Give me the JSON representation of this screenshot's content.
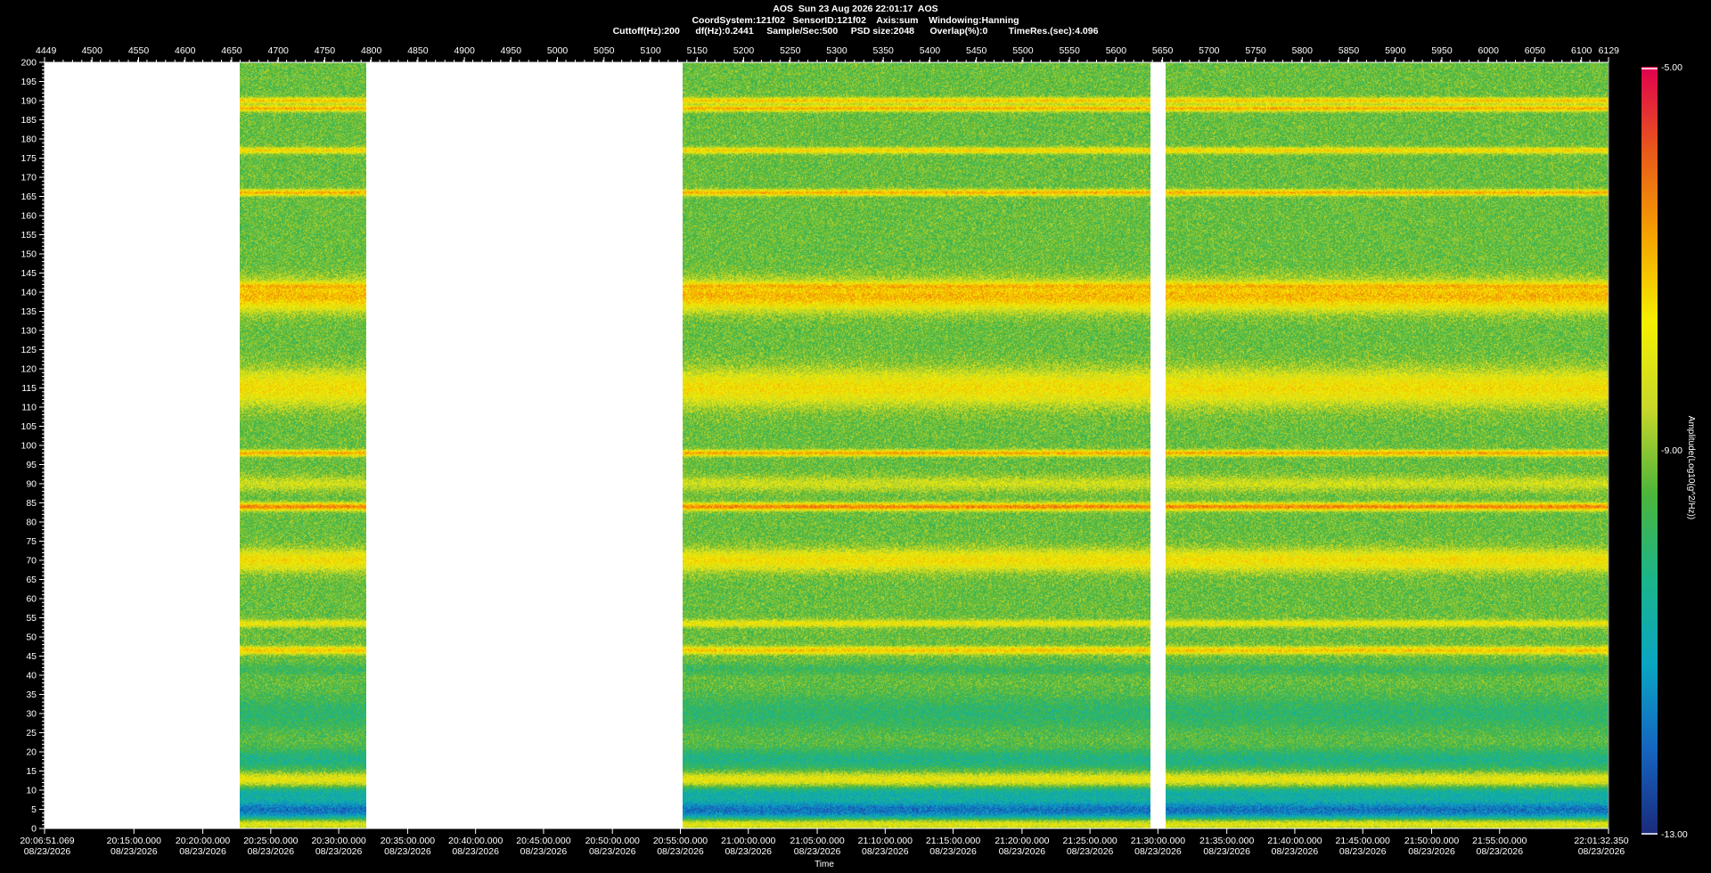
{
  "header": {
    "line1": "AOS  Sun 23 Aug 2026 22:01:17  AOS",
    "line2": "CoordSystem:121f02   SensorID:121f02    Axis:sum    Windowing:Hanning",
    "line3": "Cuttoff(Hz):200      df(Hz):0.2441     Sample/Sec:500     PSD size:2048      Overlap(%):0        TimeRes.(sec):4.096"
  },
  "chart_data": {
    "type": "heatmap",
    "title": "AOS  Sun 23 Aug 2026 22:01:17  AOS",
    "xlabel": "Time",
    "ylabel": "",
    "colorbar_label": "Amplitude(Log10(g^2/Hz))",
    "colorbar_range": [
      -13.0,
      -5.0
    ],
    "colorbar_ticks": [
      "-5.00",
      "-9.00",
      "-13.00"
    ],
    "colormap": [
      "#1a2a7a",
      "#1565c0",
      "#0aa5c2",
      "#1bb58a",
      "#4db53a",
      "#c8d72a",
      "#f5f000",
      "#f5a400",
      "#e85a1a",
      "#e00050"
    ],
    "ylim": [
      0,
      200
    ],
    "y_ticks": [
      0,
      5,
      10,
      15,
      20,
      25,
      30,
      35,
      40,
      45,
      50,
      55,
      60,
      65,
      70,
      75,
      80,
      85,
      90,
      95,
      100,
      105,
      110,
      115,
      120,
      125,
      130,
      135,
      140,
      145,
      150,
      155,
      160,
      165,
      170,
      175,
      180,
      185,
      190,
      195,
      200
    ],
    "top_axis_range": [
      4449,
      6129
    ],
    "top_axis_ticks": [
      "4449",
      "4500",
      "4550",
      "4600",
      "4650",
      "4700",
      "4750",
      "4800",
      "4850",
      "4900",
      "4950",
      "5000",
      "5050",
      "5100",
      "5150",
      "5200",
      "5250",
      "5300",
      "5350",
      "5400",
      "5450",
      "5500",
      "5550",
      "5600",
      "5650",
      "5700",
      "5750",
      "5800",
      "5850",
      "5900",
      "5950",
      "6000",
      "6050",
      "6100",
      "6129"
    ],
    "top_axis_values": [
      4449,
      4500,
      4550,
      4600,
      4650,
      4700,
      4750,
      4800,
      4850,
      4900,
      4950,
      5000,
      5050,
      5100,
      5150,
      5200,
      5250,
      5300,
      5350,
      5400,
      5450,
      5500,
      5550,
      5600,
      5650,
      5700,
      5750,
      5800,
      5850,
      5900,
      5950,
      6000,
      6050,
      6100,
      6129
    ],
    "time_axis": {
      "start": "20:06:51.069",
      "end": "22:01:32.350",
      "tick_values": [
        4449,
        4545,
        4619,
        4692,
        4765,
        4839,
        4912,
        4985,
        5059,
        5132,
        5205,
        5279,
        5352,
        5425,
        5499,
        5572,
        5645,
        5719,
        5792,
        5865,
        5939,
        6012,
        6129
      ],
      "tick_labels": [
        "20:06:51.069",
        "20:15:00.000",
        "20:20:00.000",
        "20:25:00.000",
        "20:30:00.000",
        "20:35:00.000",
        "20:40:00.000",
        "20:45:00.000",
        "20:50:00.000",
        "20:55:00.000",
        "21:00:00.000",
        "21:05:00.000",
        "21:10:00.000",
        "21:15:00.000",
        "21:20:00.000",
        "21:25:00.000",
        "21:30:00.000",
        "21:35:00.000",
        "21:40:00.000",
        "21:45:00.000",
        "21:50:00.000",
        "21:55:00.000",
        "22:01:32.350"
      ],
      "date_label": "08/23/2026"
    },
    "data_segments": [
      {
        "start": 4659,
        "end": 4795
      },
      {
        "start": 5134,
        "end": 5637
      },
      {
        "start": 5653,
        "end": 6129
      }
    ],
    "background_level": -9.3,
    "bands": [
      {
        "freq": 1.5,
        "width": 1.5,
        "level": -7.0
      },
      {
        "freq": 5,
        "width": 3,
        "level": -12.0
      },
      {
        "freq": 9,
        "width": 2.5,
        "level": -10.8
      },
      {
        "freq": 13,
        "width": 2,
        "level": -7.8
      },
      {
        "freq": 18,
        "width": 3,
        "level": -10.3
      },
      {
        "freq": 30,
        "width": 5,
        "level": -10.0
      },
      {
        "freq": 41.5,
        "width": 1.5,
        "level": -9.8
      },
      {
        "freq": 46.5,
        "width": 1,
        "level": -7.2
      },
      {
        "freq": 53.5,
        "width": 1,
        "level": -7.8
      },
      {
        "freq": 70,
        "width": 3,
        "level": -7.6
      },
      {
        "freq": 84,
        "width": 1,
        "level": -6.4
      },
      {
        "freq": 90,
        "width": 2,
        "level": -8.3
      },
      {
        "freq": 98,
        "width": 0.8,
        "level": -6.8
      },
      {
        "freq": 115,
        "width": 5,
        "level": -7.6
      },
      {
        "freq": 139,
        "width": 4,
        "level": -7.0
      },
      {
        "freq": 141.5,
        "width": 0.8,
        "level": -6.9
      },
      {
        "freq": 166,
        "width": 0.8,
        "level": -6.9
      },
      {
        "freq": 177,
        "width": 0.8,
        "level": -7.4
      },
      {
        "freq": 188,
        "width": 0.8,
        "level": -6.9
      },
      {
        "freq": 190,
        "width": 0.8,
        "level": -7.2
      }
    ]
  }
}
